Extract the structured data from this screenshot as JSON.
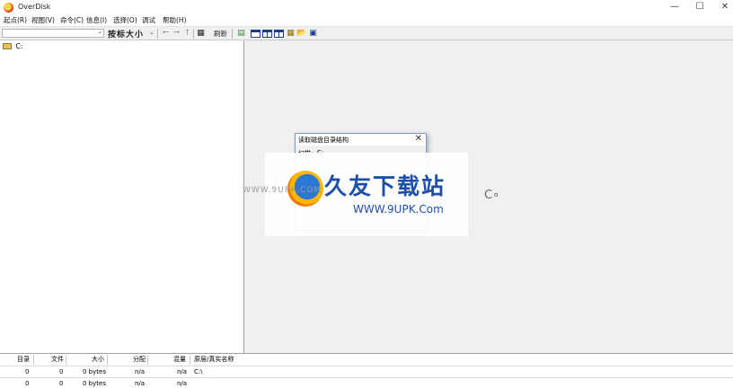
{
  "window": {
    "title": "OverDisk"
  },
  "menu": [
    "起点(R)",
    "视图(V)",
    "命令(C)",
    "信息(I)",
    "选择(O)",
    "调试",
    "帮助(H)"
  ],
  "toolbar": {
    "sort_label": "按标大小",
    "refresh_label": "刷新"
  },
  "tree": {
    "root_label": "C:"
  },
  "dialog": {
    "title": "读取磁盘目录结构",
    "scan_label": "扫描:",
    "scan_value": "C:"
  },
  "watermark": {
    "site": "WWW.9UPK.COM",
    "brand_cn": "久友下载站",
    "brand_en": "WWW.9UPK.Com"
  },
  "status": {
    "headers": [
      "目录",
      "文件",
      "大小",
      "分配",
      "混量",
      "原层/真实名称"
    ],
    "rows": [
      [
        "0",
        "0",
        "0 bytes",
        "n/a",
        "n/a",
        "C:\\"
      ],
      [
        "0",
        "0",
        "0 bytes",
        "n/a",
        "n/a",
        ""
      ]
    ]
  },
  "icons": {
    "back": "arrow-left-icon",
    "forward": "arrow-right-icon",
    "up": "arrow-up-icon",
    "refresh": "refresh-icon",
    "open": "folder-open-icon",
    "save": "save-icon"
  },
  "colors": {
    "accent": "#1e4fa8",
    "dialog_border": "#7a9ccf"
  }
}
